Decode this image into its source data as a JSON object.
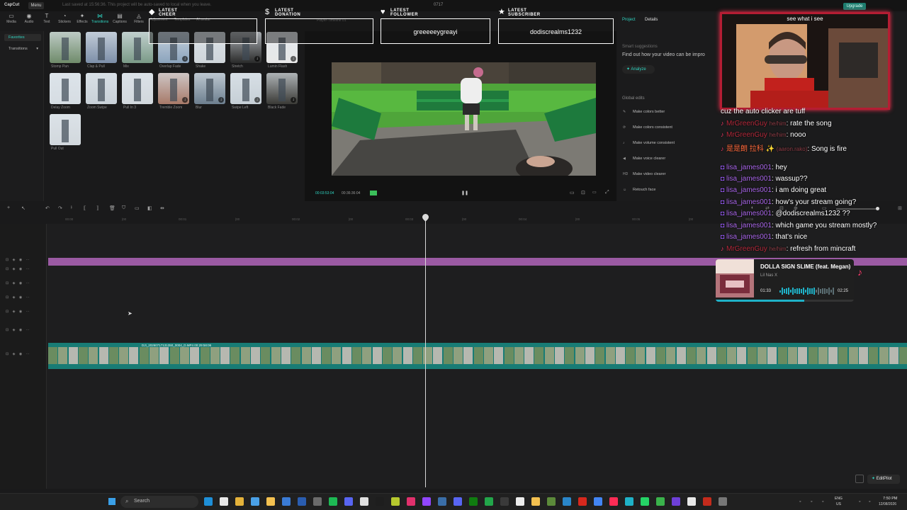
{
  "titlebar": {
    "app_name": "CapCut",
    "menu_label": "Menu",
    "autosave_note": "Last saved at 15:56:36. This project will be auto-saved to local when you leave.",
    "center_text": "0717",
    "upgrade_label": "Upgrade"
  },
  "tool_tabs": [
    {
      "label": "Media",
      "icon": "▭"
    },
    {
      "label": "Audio",
      "icon": "◉"
    },
    {
      "label": "Text",
      "icon": "T"
    },
    {
      "label": "Stickers",
      "icon": "◔"
    },
    {
      "label": "Effects",
      "icon": "✦"
    },
    {
      "label": "Transitions",
      "icon": "⋈"
    },
    {
      "label": "Captions",
      "icon": "▤"
    },
    {
      "label": "Filters",
      "icon": "◬"
    },
    {
      "label": "Adjustment",
      "icon": "⚙"
    },
    {
      "label": "Templates",
      "icon": "▦"
    },
    {
      "label": "AI avatar",
      "icon": "☺"
    }
  ],
  "sidebar": {
    "items": [
      {
        "label": "Favorites"
      },
      {
        "label": "Transitions",
        "chevron": "▾"
      }
    ]
  },
  "transitions": [
    {
      "label": "Stomp Pan",
      "color": "#6f8b6a"
    },
    {
      "label": "Clap & Pull",
      "color": "#7d8fa8"
    },
    {
      "label": "Mix",
      "color": "#7a9a87"
    },
    {
      "label": "Overlap Fade",
      "color": "#8ba3bc"
    },
    {
      "label": "Shake",
      "color": "#cfd5da"
    },
    {
      "label": "Stretch",
      "color": "#2a2a2a"
    },
    {
      "label": "Lumin Flash",
      "color": "#e8e8e8"
    },
    {
      "label": "Delay Zoom",
      "color": "#d6dde3"
    },
    {
      "label": "Zoom Swipe",
      "color": "#c9d1d8"
    },
    {
      "label": "Pull In 3",
      "color": "#d2d8dd"
    },
    {
      "label": "Tremble Zoom",
      "color": "#a77a69"
    },
    {
      "label": "Blur",
      "color": "#6d7f8f"
    },
    {
      "label": "Swipe Left",
      "color": "#c6cfd6"
    },
    {
      "label": "Black Fade",
      "color": "#3a3a36"
    },
    {
      "label": "Pull Out",
      "color": "#d2d8dd"
    }
  ],
  "widgets": [
    {
      "top": "LATEST",
      "bottom": "CHEER",
      "icon": "◆",
      "value": ""
    },
    {
      "top": "LATEST",
      "bottom": "DONATION",
      "icon": "$",
      "value": ""
    },
    {
      "top": "LATEST",
      "bottom": "FOLLOWER",
      "icon": "♥",
      "value": "greeeeeygreayi"
    },
    {
      "top": "LATEST",
      "bottom": "SUBSCRIBER",
      "icon": "★",
      "value": "dodiscrealms1232"
    }
  ],
  "player": {
    "title": "Player-Timeline 01",
    "current_time": "00:03:53:04",
    "total_time": "00:36:36:04",
    "pause_icon": "❚❚"
  },
  "right_panel": {
    "tabs": [
      "Project",
      "Details"
    ],
    "smart_title": "Smart suggestions",
    "smart_text": "Find out how your video can be impro",
    "analyze_label": "Analyze",
    "global_title": "Global edits",
    "edits": [
      {
        "icon": "✎",
        "label": "Make colors better"
      },
      {
        "icon": "⟳",
        "label": "Make colors consistent"
      },
      {
        "icon": "♪",
        "label": "Make volume consistent"
      },
      {
        "icon": "◀",
        "label": "Make voice clearer"
      },
      {
        "icon": "HD",
        "label": "Make video clearer"
      },
      {
        "icon": "☺",
        "label": "Retouch face"
      }
    ]
  },
  "timeline": {
    "ruler_ticks": [
      "00:00",
      "|00",
      "00:01",
      "|00",
      "00:02",
      "|00",
      "00:03",
      "|00",
      "00:04",
      "|00",
      "00:05",
      "|00",
      "00:06"
    ],
    "clip_name": "DJI_20260717131350_0004_D.MP4   00:29:58:06"
  },
  "webcam": {
    "title": "see what i see"
  },
  "chat": [
    {
      "user": "",
      "pronoun": "",
      "color": "#ffffff",
      "text": "cuz the auto clicker are tuff",
      "icon": ""
    },
    {
      "user": "MrGreenGuy",
      "pronoun": "he/him",
      "color": "#b5283a",
      "text": "rate the song",
      "icon": "tiktok"
    },
    {
      "user": "MrGreenGuy",
      "pronoun": "he/him",
      "color": "#b5283a",
      "text": "nooo",
      "icon": "tiktok"
    },
    {
      "user": "是是朗 拉科 ✨",
      "pronoun": "(aaron.rako)",
      "color": "#ff6a3c",
      "text": "Song is fire",
      "icon": "tiktok"
    },
    {
      "user": "lisa_james001",
      "pronoun": "",
      "color": "#a865e8",
      "text": "hey",
      "icon": "twitch"
    },
    {
      "user": "lisa_james001",
      "pronoun": "",
      "color": "#a865e8",
      "text": "wassup??",
      "icon": "twitch"
    },
    {
      "user": "lisa_james001",
      "pronoun": "",
      "color": "#a865e8",
      "text": "i am doing great",
      "icon": "twitch"
    },
    {
      "user": "lisa_james001",
      "pronoun": "",
      "color": "#a865e8",
      "text": "how's your stream going?",
      "icon": "twitch"
    },
    {
      "user": "lisa_james001",
      "pronoun": "",
      "color": "#a865e8",
      "text": "@dodiscrealms1232 ??",
      "icon": "twitch"
    },
    {
      "user": "lisa_james001",
      "pronoun": "",
      "color": "#a865e8",
      "text": "which game you stream mostly?",
      "icon": "twitch"
    },
    {
      "user": "lisa_james001",
      "pronoun": "",
      "color": "#a865e8",
      "text": "that's nice",
      "icon": "twitch"
    },
    {
      "user": "MrGreenGuy",
      "pronoun": "he/him",
      "color": "#b5283a",
      "text": "refresh from mincraft",
      "icon": "tiktok"
    }
  ],
  "music": {
    "title": "DOLLA SIGN SLIME (feat. Megan)",
    "artist": "Lil Nas X",
    "elapsed": "01:33",
    "duration": "02:25",
    "progress": 0.64
  },
  "editpilot": {
    "label": "EditPilot"
  },
  "taskbar": {
    "search_placeholder": "Search",
    "lang": "ENG",
    "lang_sub": "US",
    "time": "7:50 PM",
    "date": "12/08/2026"
  }
}
